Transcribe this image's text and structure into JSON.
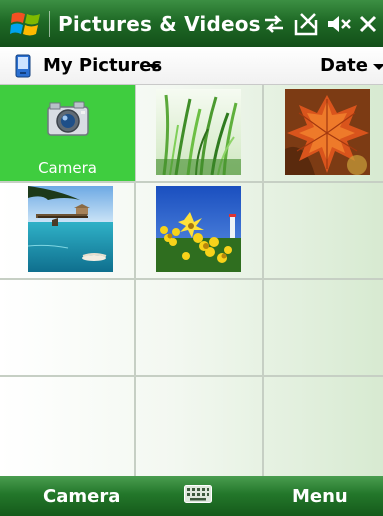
{
  "title_bar": {
    "app_title": "Pictures & Videos",
    "icons": [
      "windows-logo-icon",
      "connectivity-icon",
      "no-signal-icon",
      "volume-muted-icon",
      "close-icon"
    ]
  },
  "folder_bar": {
    "folder": "My Pictures",
    "sort": "Date"
  },
  "grid": {
    "items": [
      {
        "type": "action",
        "label": "Camera",
        "selected": true
      },
      {
        "type": "photo",
        "subject": "grass"
      },
      {
        "type": "photo",
        "subject": "autumn-leaf"
      },
      {
        "type": "photo",
        "subject": "beach-pier"
      },
      {
        "type": "photo",
        "subject": "yellow-flowers"
      }
    ]
  },
  "soft_keys": {
    "left": "Camera",
    "right": "Menu"
  },
  "colors": {
    "title_bar": "#1f6a26",
    "selection": "#3fcd3f",
    "grid_line": "#c6cfc4"
  }
}
